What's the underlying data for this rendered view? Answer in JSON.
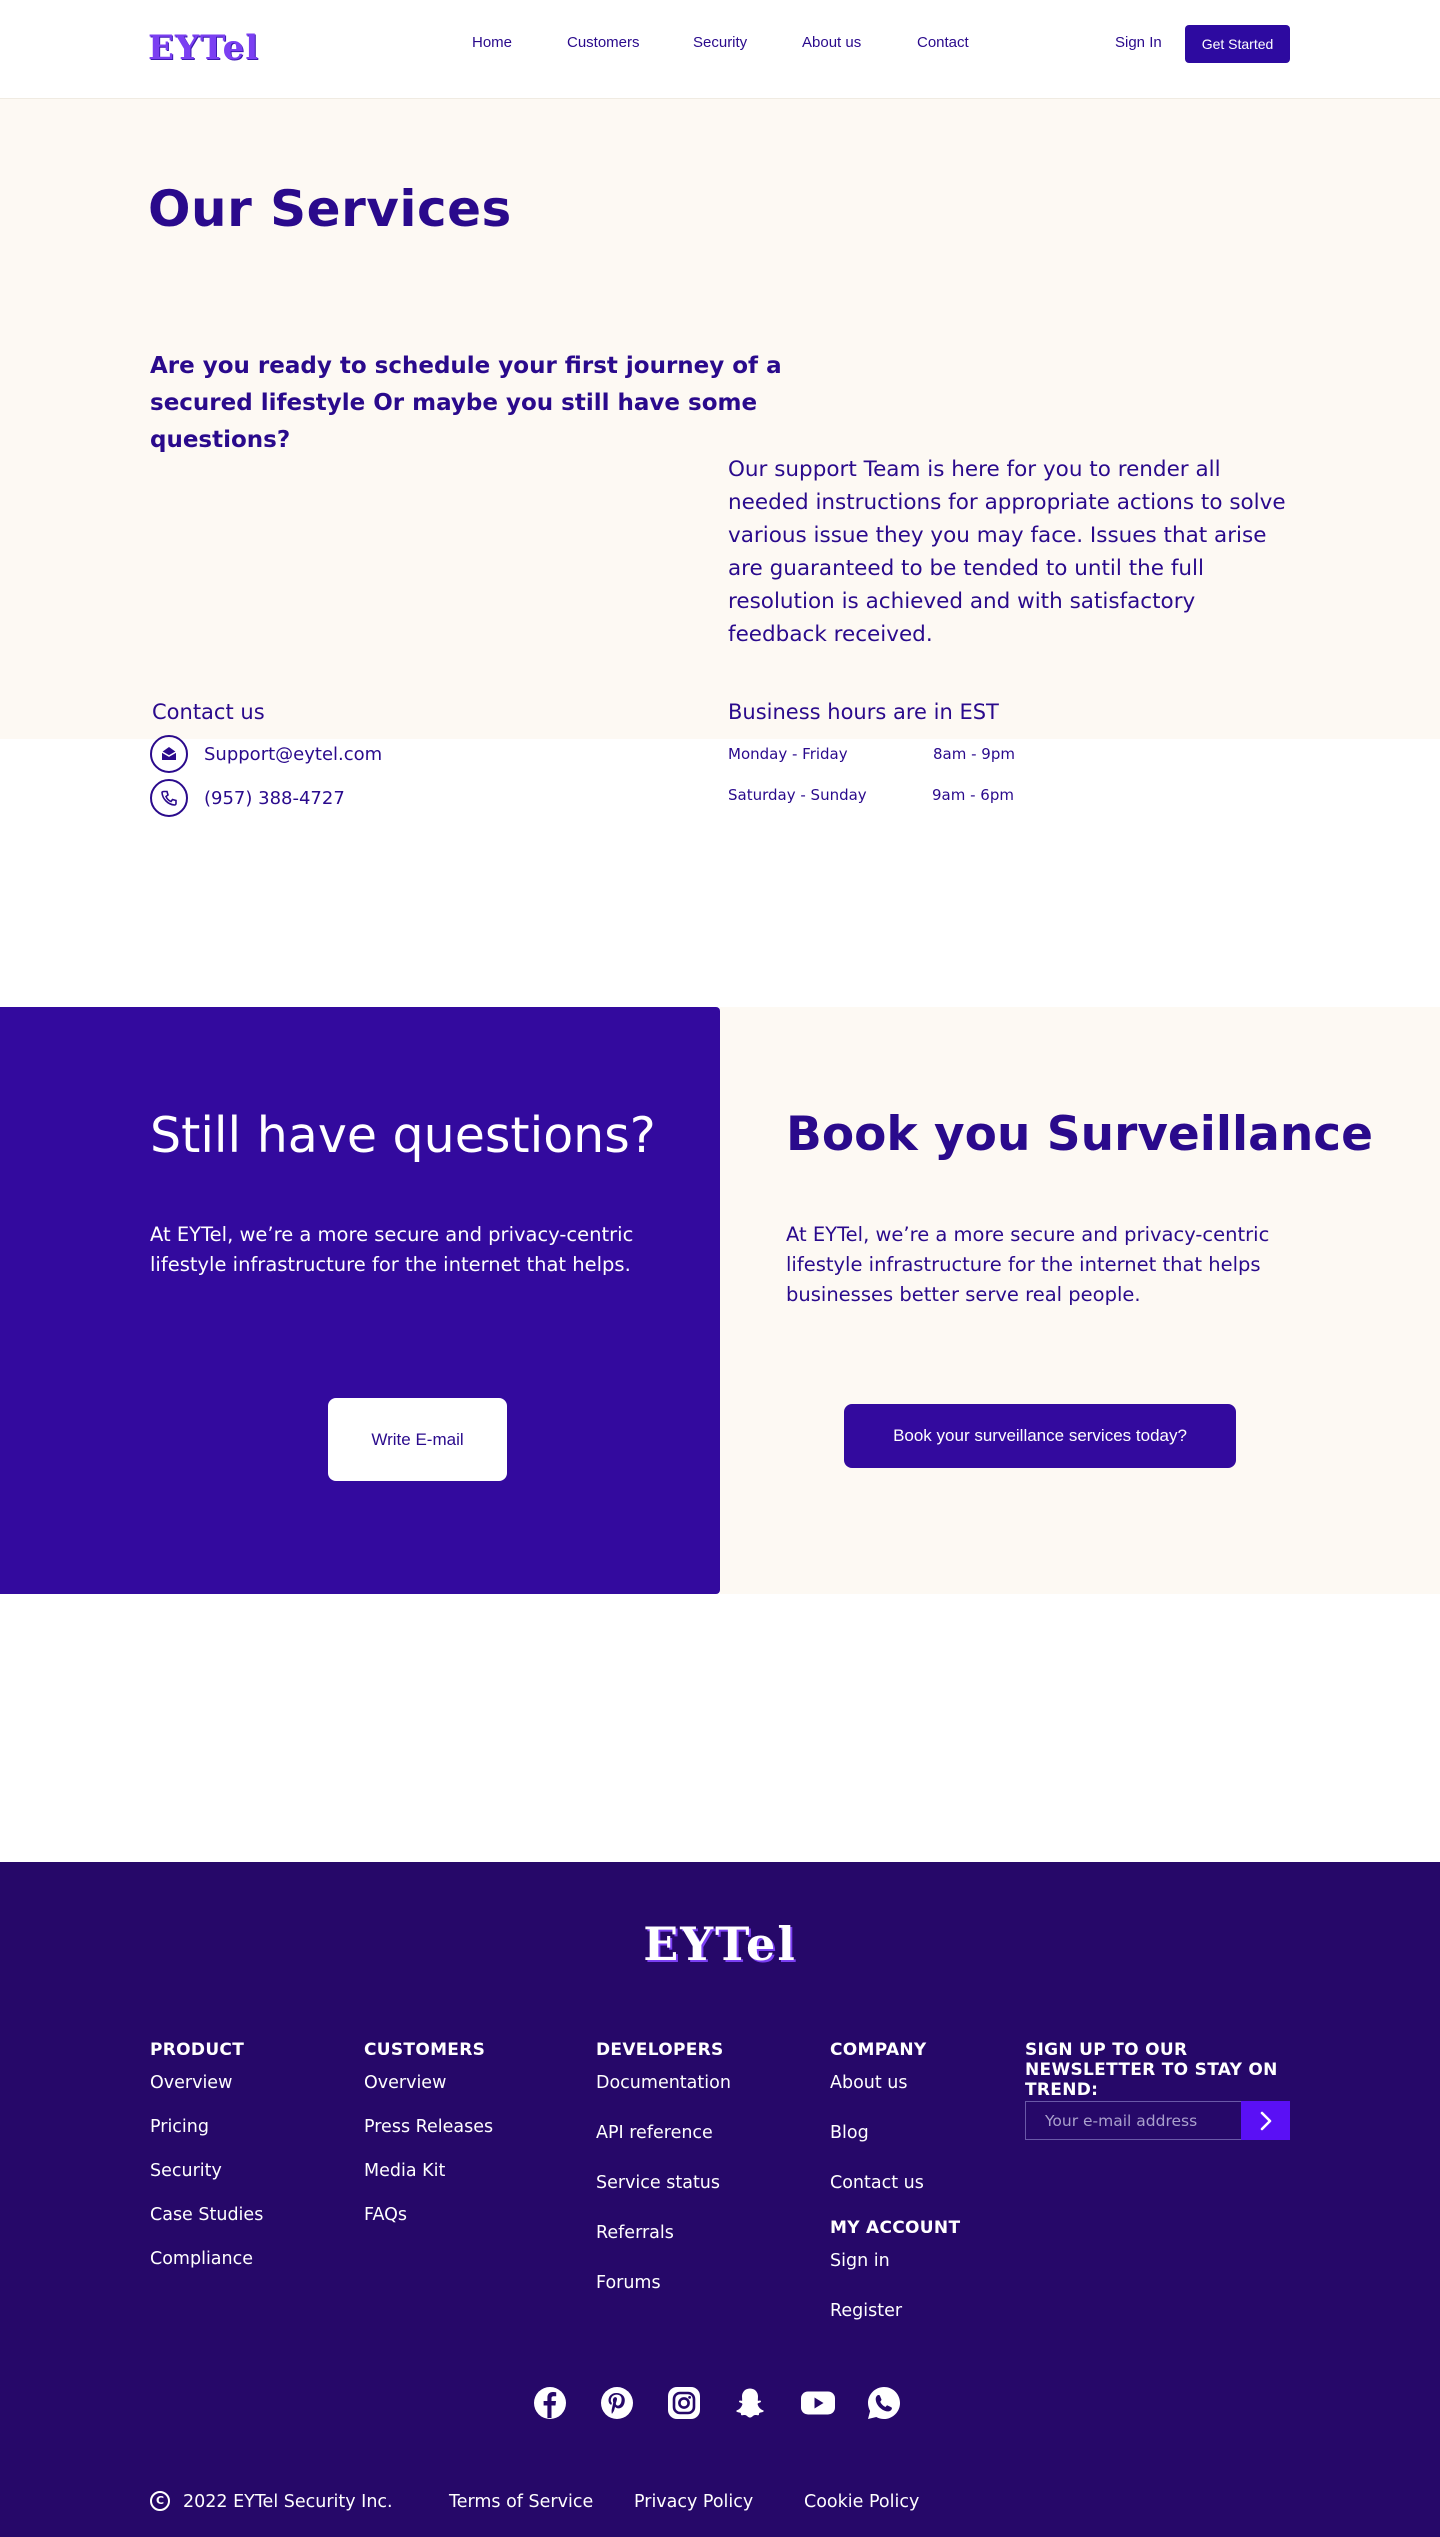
{
  "header": {
    "logo": "EYTel",
    "nav": [
      "Home",
      "Customers",
      "Security",
      "About us",
      "Contact"
    ],
    "sign_in": "Sign In",
    "get_started": "Get Started"
  },
  "services": {
    "title": "Our Services",
    "lead": "Are you ready to schedule your first journey of a secured lifestyle Or maybe you still have some questions?",
    "support_text": "Our support Team is here for you to render all needed instructions for appropriate actions to solve various issue they you may face. Issues that arise are guaranteed to be tended to until the full resolution is achieved and with satisfactory feedback received."
  },
  "contact": {
    "title": "Contact us",
    "email": "Support@eytel.com",
    "phone": "(957) 388-4727"
  },
  "hours": {
    "title": "Business hours are in EST",
    "rows": [
      {
        "days": "Monday - Friday",
        "time": "8am - 9pm"
      },
      {
        "days": "Saturday - Sunday",
        "time": "9am - 6pm"
      }
    ]
  },
  "cta_left": {
    "title": "Still have questions?",
    "text": "At EYTel, we’re a more secure and privacy-centric lifestyle infrastructure for the internet that helps.",
    "button": "Write E-mail"
  },
  "cta_right": {
    "title": "Book you Surveillance",
    "text": "At EYTel, we’re a more secure and privacy-centric lifestyle infrastructure for the internet that helps businesses better serve real people.",
    "button": "Book your surveillance services today?"
  },
  "footer": {
    "logo": "EYTel",
    "product": {
      "heading": "PRODUCT",
      "links": [
        "Overview",
        "Pricing",
        "Security",
        "Case Studies",
        "Compliance"
      ]
    },
    "customers": {
      "heading": "CUSTOMERS",
      "links": [
        "Overview",
        "Press Releases",
        "Media Kit",
        "FAQs"
      ]
    },
    "developers": {
      "heading": "DEVELOPERS",
      "links": [
        "Documentation",
        "API reference",
        "Service status",
        "Referrals",
        "Forums"
      ]
    },
    "company": {
      "heading": "COMPANY",
      "links": [
        "About us",
        "Blog",
        "Contact us"
      ]
    },
    "account": {
      "heading": "MY ACCOUNT",
      "links": [
        "Sign in",
        "Register"
      ]
    },
    "newsletter": {
      "title": "SIGN UP TO OUR NEWSLETTER TO STAY ON TREND:",
      "placeholder": "Your e-mail address"
    },
    "social": [
      "facebook-icon",
      "pinterest-icon",
      "instagram-icon",
      "snapchat-icon",
      "youtube-icon",
      "whatsapp-icon"
    ],
    "copyright": "2022 EYTel Security Inc.",
    "legal": [
      "Terms of Service",
      "Privacy Policy",
      "Cookie Policy"
    ]
  },
  "colors": {
    "primary": "#2A0A8C",
    "cta_purple": "#330A9E",
    "footer_bg": "#260869",
    "cream": "#FDF9F3",
    "accent": "#5A10F5"
  }
}
